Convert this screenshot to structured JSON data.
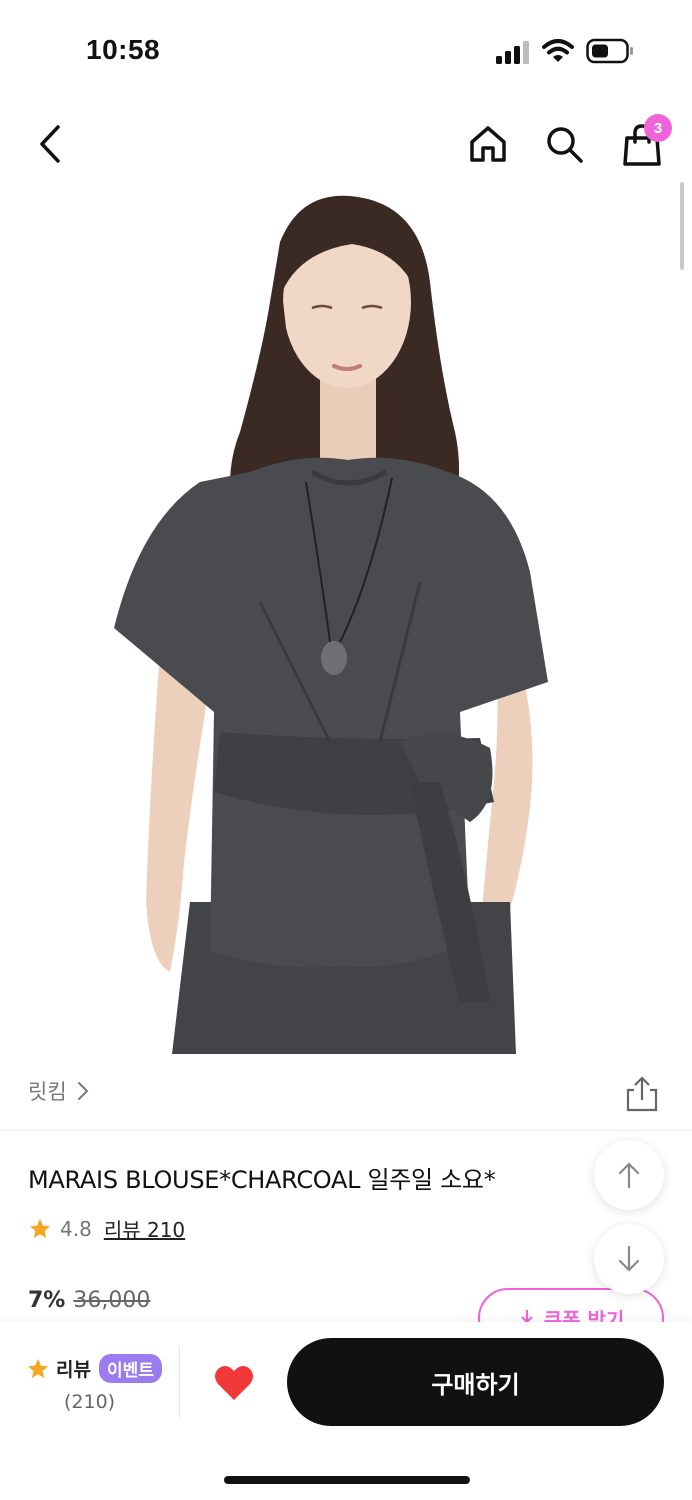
{
  "status": {
    "time": "10:58"
  },
  "nav": {
    "cart_count": "3"
  },
  "brand": {
    "name": "릿킴"
  },
  "product": {
    "title": "MARAIS BLOUSE*CHARCOAL 일주일 소요*",
    "rating": "4.8",
    "review_link": "리뷰 210",
    "discount": "7%",
    "original_price": "36,000",
    "coupon_label": "쿠폰 받기"
  },
  "bottom": {
    "review_label": "리뷰",
    "event_badge": "이벤트",
    "review_count": "(210)",
    "buy_label": "구매하기"
  },
  "colors": {
    "accent_pink": "#ef64d8",
    "event_purple": "#9b7cf0",
    "heart_red": "#f03838",
    "star": "#f5a623",
    "garment": "#4a4b4e"
  }
}
